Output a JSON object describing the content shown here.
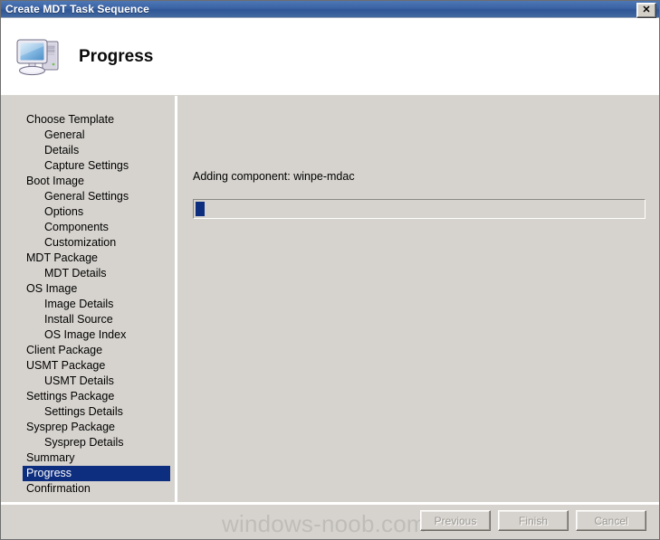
{
  "window": {
    "title": "Create MDT Task Sequence",
    "close_label": "✕"
  },
  "header": {
    "title": "Progress",
    "icon": "computer-icon"
  },
  "sidebar": {
    "items": [
      {
        "label": "Choose Template",
        "level": 0,
        "selected": false
      },
      {
        "label": "General",
        "level": 1,
        "selected": false
      },
      {
        "label": "Details",
        "level": 1,
        "selected": false
      },
      {
        "label": "Capture Settings",
        "level": 1,
        "selected": false
      },
      {
        "label": "Boot Image",
        "level": 0,
        "selected": false
      },
      {
        "label": "General Settings",
        "level": 1,
        "selected": false
      },
      {
        "label": "Options",
        "level": 1,
        "selected": false
      },
      {
        "label": "Components",
        "level": 1,
        "selected": false
      },
      {
        "label": "Customization",
        "level": 1,
        "selected": false
      },
      {
        "label": "MDT Package",
        "level": 0,
        "selected": false
      },
      {
        "label": "MDT Details",
        "level": 1,
        "selected": false
      },
      {
        "label": "OS Image",
        "level": 0,
        "selected": false
      },
      {
        "label": "Image Details",
        "level": 1,
        "selected": false
      },
      {
        "label": "Install Source",
        "level": 1,
        "selected": false
      },
      {
        "label": "OS Image Index",
        "level": 1,
        "selected": false
      },
      {
        "label": "Client Package",
        "level": 0,
        "selected": false
      },
      {
        "label": "USMT Package",
        "level": 0,
        "selected": false
      },
      {
        "label": "USMT Details",
        "level": 1,
        "selected": false
      },
      {
        "label": "Settings Package",
        "level": 0,
        "selected": false
      },
      {
        "label": "Settings Details",
        "level": 1,
        "selected": false
      },
      {
        "label": "Sysprep Package",
        "level": 0,
        "selected": false
      },
      {
        "label": "Sysprep Details",
        "level": 1,
        "selected": false
      },
      {
        "label": "Summary",
        "level": 0,
        "selected": false
      },
      {
        "label": "Progress",
        "level": 0,
        "selected": true
      },
      {
        "label": "Confirmation",
        "level": 0,
        "selected": false
      }
    ]
  },
  "main": {
    "status_text": "Adding component: winpe-mdac",
    "progress_percent": 2
  },
  "footer": {
    "watermark": "windows-noob.com",
    "buttons": [
      {
        "label": "Previous",
        "disabled": true
      },
      {
        "label": "Finish",
        "disabled": true
      },
      {
        "label": "Cancel",
        "disabled": true
      }
    ]
  },
  "colors": {
    "titlebar_blue": "#3b63a4",
    "selection_navy": "#0d2d7f",
    "dialog_grey": "#d6d3ce",
    "watermark_grey": "#c0bdb8"
  }
}
